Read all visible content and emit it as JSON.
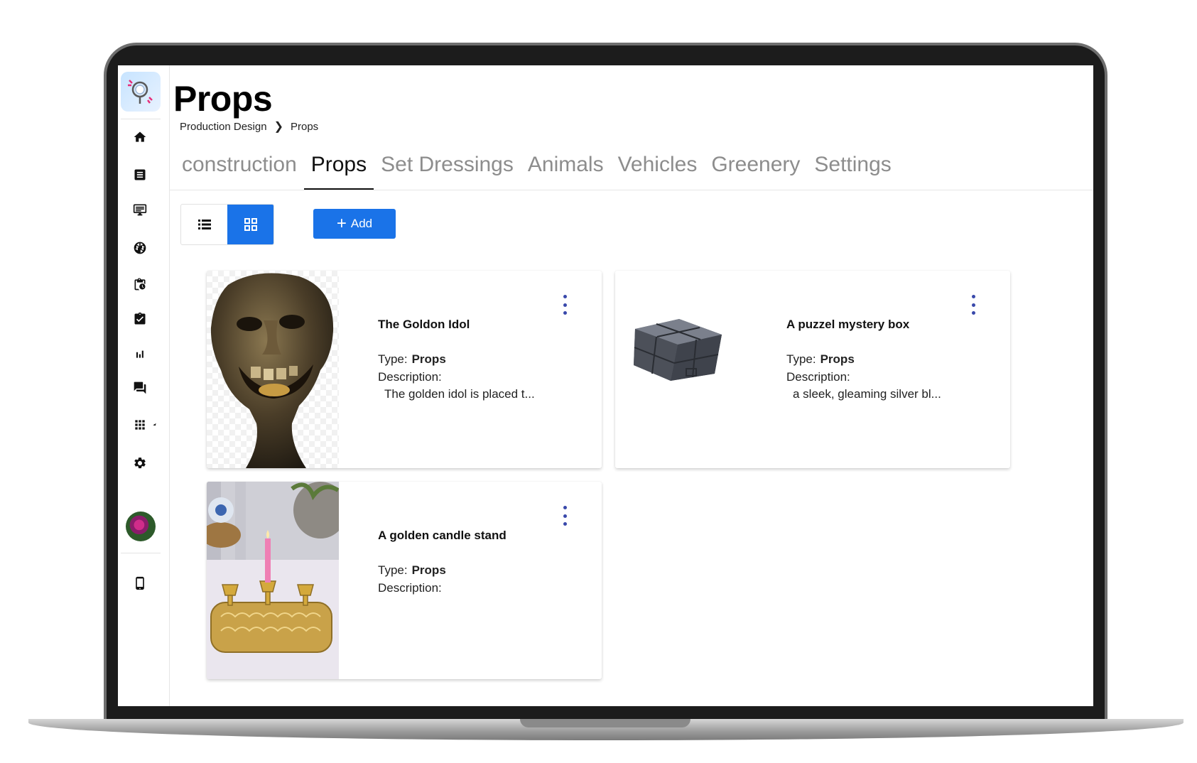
{
  "page": {
    "title": "Props",
    "breadcrumb": [
      "Production Design",
      "Props"
    ]
  },
  "tabs": [
    {
      "label": "construction",
      "active": false
    },
    {
      "label": "Props",
      "active": true
    },
    {
      "label": "Set Dressings",
      "active": false
    },
    {
      "label": "Animals",
      "active": false
    },
    {
      "label": "Vehicles",
      "active": false
    },
    {
      "label": "Greenery",
      "active": false
    },
    {
      "label": "Settings",
      "active": false
    }
  ],
  "toolbar": {
    "view_mode": "grid",
    "add_label": "Add"
  },
  "sidebar": {
    "icons": [
      "home-icon",
      "document-icon",
      "presentation-icon",
      "camera-shutter-icon",
      "clipboard-clock-icon",
      "checklist-icon",
      "bar-chart-icon",
      "chat-icon",
      "apps-grid-icon",
      "settings-icon",
      "avatar",
      "mobile-icon"
    ]
  },
  "cards": [
    {
      "title": "The Goldon Idol",
      "type_label": "Type:",
      "type": "Props",
      "description_label": "Description:",
      "description": "The golden idol is placed t..."
    },
    {
      "title": "A puzzel mystery box",
      "type_label": "Type:",
      "type": "Props",
      "description_label": "Description:",
      "description": "a sleek, gleaming silver bl..."
    },
    {
      "title": "A golden candle stand",
      "type_label": "Type:",
      "type": "Props",
      "description_label": "Description:",
      "description": ""
    }
  ],
  "colors": {
    "accent": "#1a73e8",
    "kebab": "#3949ab",
    "tab_inactive": "#8d8d8d"
  }
}
